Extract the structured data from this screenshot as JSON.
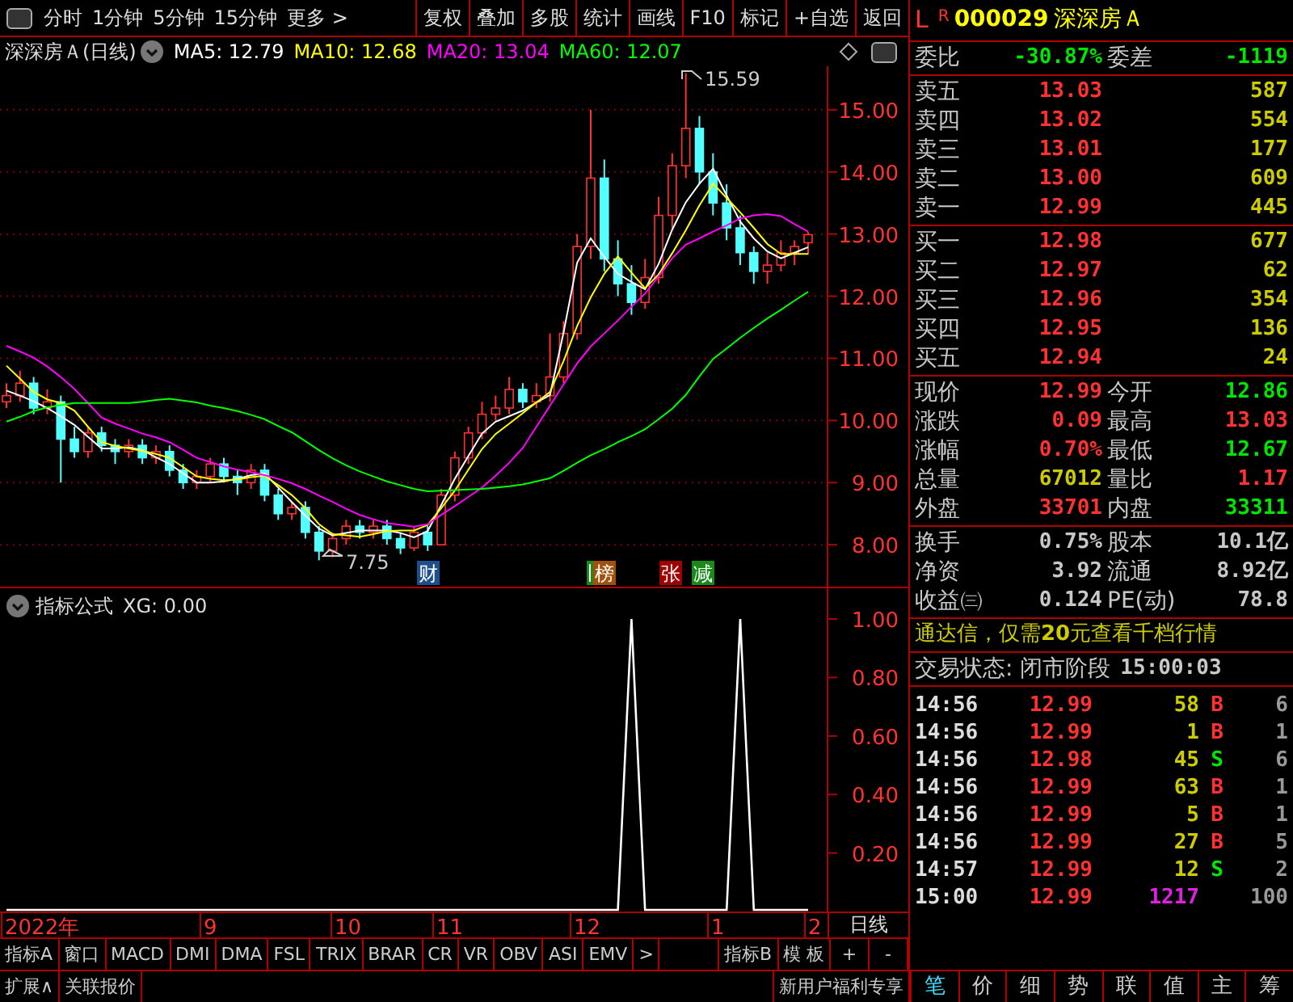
{
  "toolbar": {
    "periods": [
      "分时",
      "1分钟",
      "5分钟",
      "15分钟",
      "更多 >"
    ],
    "buttons": [
      "复权",
      "叠加",
      "多股",
      "统计",
      "画线",
      "F10",
      "标记",
      "+自选",
      "返回"
    ]
  },
  "main_chart": {
    "title": "深深房Ａ(日线)",
    "moving_averages": [
      {
        "label": "MA5: 12.79",
        "color": "#ffffff"
      },
      {
        "label": "MA10: 12.68",
        "color": "#ffff00"
      },
      {
        "label": "MA20: 13.04",
        "color": "#ff00ff"
      },
      {
        "label": "MA60: 12.07",
        "color": "#00ff00"
      }
    ],
    "high_label": "15.59",
    "low_label": "7.75",
    "markers": [
      {
        "text": "财",
        "color": "#1c4f8c"
      },
      {
        "text": "榜",
        "color": "#a0520a"
      },
      {
        "text": "张",
        "color": "#a00000"
      },
      {
        "text": "减",
        "color": "#1a8a1a"
      }
    ],
    "chart_data": {
      "type": "candlestick",
      "grid": true,
      "ylim": [
        7.3,
        15.7
      ],
      "yticks": [
        {
          "value": 15,
          "label": "15.00"
        },
        {
          "value": 14,
          "label": "14.00"
        },
        {
          "value": 13,
          "label": "13.00"
        },
        {
          "value": 12,
          "label": "12.00"
        },
        {
          "value": 11,
          "label": "11.00"
        },
        {
          "value": 10,
          "label": "10.00"
        },
        {
          "value": 9,
          "label": "9.00"
        },
        {
          "value": 8,
          "label": "8.00"
        }
      ],
      "ohlc": [
        [
          10.3,
          10.6,
          10.2,
          10.4
        ],
        [
          10.4,
          10.8,
          10.3,
          10.6
        ],
        [
          10.6,
          10.7,
          10.1,
          10.2
        ],
        [
          10.2,
          10.5,
          10.1,
          10.3
        ],
        [
          10.3,
          10.4,
          9.0,
          9.7
        ],
        [
          9.7,
          9.9,
          9.4,
          9.5
        ],
        [
          9.5,
          9.9,
          9.4,
          9.8
        ],
        [
          9.8,
          9.9,
          9.5,
          9.6
        ],
        [
          9.6,
          9.7,
          9.3,
          9.5
        ],
        [
          9.5,
          9.7,
          9.4,
          9.6
        ],
        [
          9.6,
          9.7,
          9.3,
          9.4
        ],
        [
          9.4,
          9.6,
          9.3,
          9.5
        ],
        [
          9.5,
          9.6,
          9.1,
          9.2
        ],
        [
          9.2,
          9.3,
          8.9,
          9.0
        ],
        [
          9.0,
          9.2,
          8.9,
          9.1
        ],
        [
          9.1,
          9.4,
          9.0,
          9.3
        ],
        [
          9.3,
          9.4,
          9.0,
          9.1
        ],
        [
          9.1,
          9.2,
          8.8,
          9.0
        ],
        [
          9.0,
          9.3,
          8.9,
          9.2
        ],
        [
          9.2,
          9.3,
          8.7,
          8.8
        ],
        [
          8.8,
          8.9,
          8.4,
          8.5
        ],
        [
          8.5,
          8.7,
          8.4,
          8.6
        ],
        [
          8.6,
          8.7,
          8.1,
          8.2
        ],
        [
          8.2,
          8.3,
          7.75,
          7.9
        ],
        [
          7.9,
          8.2,
          7.8,
          8.1
        ],
        [
          8.1,
          8.4,
          8.0,
          8.3
        ],
        [
          8.3,
          8.4,
          8.1,
          8.2
        ],
        [
          8.2,
          8.4,
          8.1,
          8.3
        ],
        [
          8.3,
          8.4,
          8.0,
          8.1
        ],
        [
          8.1,
          8.2,
          7.85,
          7.95
        ],
        [
          7.95,
          8.3,
          7.9,
          8.2
        ],
        [
          8.2,
          8.3,
          7.9,
          8.0
        ],
        [
          8.0,
          8.9,
          8.0,
          8.8
        ],
        [
          8.8,
          9.5,
          8.7,
          9.4
        ],
        [
          9.4,
          9.9,
          9.3,
          9.8
        ],
        [
          9.8,
          10.3,
          9.7,
          10.1
        ],
        [
          10.1,
          10.4,
          10.0,
          10.2
        ],
        [
          10.2,
          10.7,
          10.1,
          10.5
        ],
        [
          10.5,
          10.6,
          10.2,
          10.3
        ],
        [
          10.3,
          10.6,
          10.2,
          10.4
        ],
        [
          10.4,
          11.4,
          10.3,
          10.7
        ],
        [
          10.7,
          11.6,
          10.6,
          11.4
        ],
        [
          11.4,
          13.0,
          11.3,
          12.8
        ],
        [
          12.8,
          15.0,
          12.6,
          13.9
        ],
        [
          13.9,
          14.2,
          12.4,
          12.6
        ],
        [
          12.6,
          12.9,
          12.0,
          12.2
        ],
        [
          12.2,
          12.5,
          11.7,
          11.9
        ],
        [
          11.9,
          12.6,
          11.8,
          12.3
        ],
        [
          12.3,
          13.6,
          12.2,
          13.3
        ],
        [
          13.3,
          14.3,
          13.1,
          14.1
        ],
        [
          14.1,
          15.59,
          13.9,
          14.7
        ],
        [
          14.7,
          14.9,
          13.8,
          14.0
        ],
        [
          14.0,
          14.3,
          13.3,
          13.5
        ],
        [
          13.5,
          13.8,
          12.9,
          13.1
        ],
        [
          13.1,
          13.3,
          12.5,
          12.7
        ],
        [
          12.7,
          12.8,
          12.2,
          12.4
        ],
        [
          12.4,
          12.7,
          12.2,
          12.5
        ],
        [
          12.5,
          12.9,
          12.4,
          12.7
        ],
        [
          12.7,
          12.9,
          12.5,
          12.8
        ],
        [
          12.86,
          13.03,
          12.67,
          12.99
        ]
      ],
      "series": [
        {
          "type": "line",
          "color": "#ffffff",
          "values": [
            10.48,
            10.4,
            10.31,
            10.2,
            10.07,
            9.93,
            9.74,
            9.55,
            9.55,
            9.57,
            9.52,
            9.41,
            9.3,
            9.15,
            9.0,
            9.0,
            9.02,
            9.06,
            9.12,
            9.15,
            8.92,
            8.69,
            8.47,
            8.26,
            8.15,
            8.19,
            8.23,
            8.23,
            8.23,
            8.19,
            8.12,
            8.22,
            8.64,
            9.06,
            9.43,
            9.79,
            9.98,
            10.07,
            10.16,
            10.29,
            10.41,
            11.42,
            12.54,
            12.93,
            12.63,
            12.36,
            12.23,
            12.11,
            12.52,
            13.07,
            13.51,
            13.81,
            14.05,
            13.62,
            13.2,
            12.93,
            12.72,
            12.61,
            12.7,
            12.79
          ]
        },
        {
          "type": "line",
          "color": "#ffff00",
          "values": [
            10.88,
            10.67,
            10.46,
            10.34,
            10.28,
            10.16,
            9.9,
            9.65,
            9.59,
            9.55,
            9.51,
            9.46,
            9.4,
            9.25,
            9.1,
            9.06,
            9.04,
            9.05,
            9.09,
            9.11,
            8.96,
            8.8,
            8.59,
            8.33,
            8.17,
            8.15,
            8.13,
            8.17,
            8.22,
            8.23,
            8.23,
            8.32,
            8.59,
            8.87,
            9.21,
            9.54,
            9.78,
            9.95,
            10.12,
            10.29,
            10.46,
            10.96,
            11.52,
            11.98,
            12.36,
            12.64,
            12.38,
            12.13,
            12.35,
            12.69,
            13.06,
            13.46,
            13.81,
            13.58,
            13.35,
            13.1,
            12.84,
            12.68,
            12.68,
            12.68
          ]
        },
        {
          "type": "line",
          "color": "#ff00ff",
          "values": [
            11.2,
            11.11,
            11.01,
            10.87,
            10.7,
            10.51,
            10.28,
            10.05,
            9.95,
            9.87,
            9.79,
            9.73,
            9.65,
            9.53,
            9.4,
            9.33,
            9.26,
            9.21,
            9.17,
            9.12,
            9.06,
            8.99,
            8.9,
            8.79,
            8.69,
            8.58,
            8.48,
            8.41,
            8.35,
            8.32,
            8.29,
            8.33,
            8.48,
            8.62,
            8.77,
            8.92,
            9.11,
            9.32,
            9.56,
            9.9,
            10.24,
            10.58,
            10.92,
            11.19,
            11.4,
            11.61,
            11.83,
            12.04,
            12.32,
            12.61,
            12.83,
            12.93,
            13.04,
            13.14,
            13.25,
            13.3,
            13.32,
            13.29,
            13.16,
            13.04
          ]
        },
        {
          "type": "line",
          "color": "#00ff00",
          "values": [
            9.98,
            10.06,
            10.15,
            10.21,
            10.25,
            10.28,
            10.28,
            10.28,
            10.28,
            10.28,
            10.3,
            10.33,
            10.35,
            10.32,
            10.29,
            10.24,
            10.2,
            10.15,
            10.09,
            10.02,
            9.91,
            9.81,
            9.67,
            9.52,
            9.39,
            9.28,
            9.18,
            9.1,
            9.02,
            8.96,
            8.9,
            8.86,
            8.87,
            8.88,
            8.89,
            8.9,
            8.92,
            8.94,
            8.97,
            9.02,
            9.07,
            9.19,
            9.32,
            9.44,
            9.54,
            9.65,
            9.75,
            9.86,
            10.02,
            10.19,
            10.41,
            10.71,
            10.99,
            11.16,
            11.33,
            11.49,
            11.64,
            11.78,
            11.93,
            12.07
          ]
        }
      ]
    }
  },
  "indicator": {
    "title": "指标公式",
    "reading": "XG: 0.00",
    "chart_data": {
      "type": "line",
      "ylim": [
        0,
        1.105
      ],
      "yticks": [
        {
          "value": 1,
          "label": "1.00"
        },
        {
          "value": 0.8,
          "label": "0.80"
        },
        {
          "value": 0.6,
          "label": "0.60"
        },
        {
          "value": 0.4,
          "label": "0.40"
        },
        {
          "value": 0.2,
          "label": "0.20"
        }
      ],
      "series": [
        {
          "color": "#ffffff",
          "values": [
            0,
            0,
            0,
            0,
            0,
            0,
            0,
            0,
            0,
            0,
            0,
            0,
            0,
            0,
            0,
            0,
            0,
            0,
            0,
            0,
            0,
            0,
            0,
            0,
            0,
            0,
            0,
            0,
            0,
            0,
            0,
            0,
            0,
            0,
            0,
            0,
            0,
            0,
            0,
            0,
            0,
            0,
            0,
            0,
            0,
            0,
            1,
            0,
            0,
            0,
            0,
            0,
            0,
            0,
            1,
            0,
            0,
            0,
            0,
            0
          ]
        }
      ]
    }
  },
  "date_axis": {
    "labels": [
      "2022年",
      "9",
      "10",
      "11",
      "12",
      "1",
      "2"
    ],
    "period": "日线"
  },
  "indicator_tabs": [
    "指标A",
    "窗口",
    "MACD",
    "DMI",
    "DMA",
    "FSL",
    "TRIX",
    "BRAR",
    "CR",
    "VR",
    "OBV",
    "ASI",
    "EMV",
    ">"
  ],
  "indicator_tabs_right": [
    "指标B",
    "模 板",
    "+",
    "-"
  ],
  "bottom_bar": {
    "buttons": [
      "扩展∧",
      "关联报价"
    ],
    "promo": "新用户福利专享"
  },
  "quote": {
    "market": "L",
    "flag": "R",
    "code": "000029",
    "name": "深深房Ａ",
    "order_ratio": {
      "label": "委比",
      "value": "-30.87%",
      "label2": "委差",
      "value2": "-1119"
    },
    "sell": [
      {
        "label": "卖五",
        "price": "13.03",
        "volume": "587"
      },
      {
        "label": "卖四",
        "price": "13.02",
        "volume": "554"
      },
      {
        "label": "卖三",
        "price": "13.01",
        "volume": "177"
      },
      {
        "label": "卖二",
        "price": "13.00",
        "volume": "609"
      },
      {
        "label": "卖一",
        "price": "12.99",
        "volume": "445"
      }
    ],
    "buy": [
      {
        "label": "买一",
        "price": "12.98",
        "volume": "677"
      },
      {
        "label": "买二",
        "price": "12.97",
        "volume": "62"
      },
      {
        "label": "买三",
        "price": "12.96",
        "volume": "354"
      },
      {
        "label": "买四",
        "price": "12.95",
        "volume": "136"
      },
      {
        "label": "买五",
        "price": "12.94",
        "volume": "24"
      }
    ],
    "stats": [
      [
        {
          "label": "现价",
          "value": "12.99",
          "color": "#ff3232"
        },
        {
          "label": "今开",
          "value": "12.86",
          "color": "#00e600"
        }
      ],
      [
        {
          "label": "涨跌",
          "value": "0.09",
          "color": "#ff3232"
        },
        {
          "label": "最高",
          "value": "13.03",
          "color": "#ff3232"
        }
      ],
      [
        {
          "label": "涨幅",
          "value": "0.70%",
          "color": "#ff3232"
        },
        {
          "label": "最低",
          "value": "12.67",
          "color": "#00e600"
        }
      ],
      [
        {
          "label": "总量",
          "value": "67012",
          "color": "#cccc00"
        },
        {
          "label": "量比",
          "value": "1.17",
          "color": "#ff3232"
        }
      ],
      [
        {
          "label": "外盘",
          "value": "33701",
          "color": "#ff3232"
        },
        {
          "label": "内盘",
          "value": "33311",
          "color": "#00e600"
        }
      ]
    ],
    "finance": [
      {
        "label": "换手",
        "value": "0.75%",
        "label2": "股本",
        "value2": "10.1亿"
      },
      {
        "label": "净资",
        "value": "3.92",
        "label2": "流通",
        "value2": "8.92亿"
      },
      {
        "label": "收益㈢",
        "value": "0.124",
        "label2": "PE(动)",
        "value2": "78.8"
      }
    ],
    "ad": "通达信，仅需**20**元查看千档行情",
    "status": {
      "text": "交易状态: 闭市阶段",
      "time": "15:00:03"
    },
    "trades": [
      {
        "kind": "trade",
        "time": "14:56",
        "price": "12.99",
        "volume": "58",
        "side": "B",
        "color": "#ff3232",
        "extra": "6"
      },
      {
        "kind": "trade",
        "time": "14:56",
        "price": "12.99",
        "volume": "1",
        "side": "B",
        "color": "#ff3232",
        "extra": "1"
      },
      {
        "kind": "trade",
        "time": "14:56",
        "price": "12.98",
        "volume": "45",
        "side": "S",
        "color": "#00e600",
        "extra": "6"
      },
      {
        "kind": "trade",
        "time": "14:56",
        "price": "12.99",
        "volume": "63",
        "side": "B",
        "color": "#ff3232",
        "extra": "1"
      },
      {
        "kind": "trade",
        "time": "14:56",
        "price": "12.99",
        "volume": "5",
        "side": "B",
        "color": "#ff3232",
        "extra": "1"
      },
      {
        "kind": "trade",
        "time": "14:56",
        "price": "12.99",
        "volume": "27",
        "side": "B",
        "color": "#ff3232",
        "extra": "5"
      },
      {
        "kind": "trade",
        "time": "14:57",
        "price": "12.99",
        "volume": "12",
        "side": "S",
        "color": "#00e600",
        "extra": "2"
      },
      {
        "kind": "auction",
        "time": "15:00",
        "price": "12.99",
        "volume": "1217",
        "extra": "100"
      }
    ],
    "tabs": [
      {
        "label": "笔",
        "selected": true
      },
      {
        "label": "价",
        "selected": false
      },
      {
        "label": "细",
        "selected": false
      },
      {
        "label": "势",
        "selected": false
      },
      {
        "label": "联",
        "selected": false
      },
      {
        "label": "值",
        "selected": false
      },
      {
        "label": "主",
        "selected": false
      },
      {
        "label": "筹",
        "selected": false
      }
    ]
  }
}
